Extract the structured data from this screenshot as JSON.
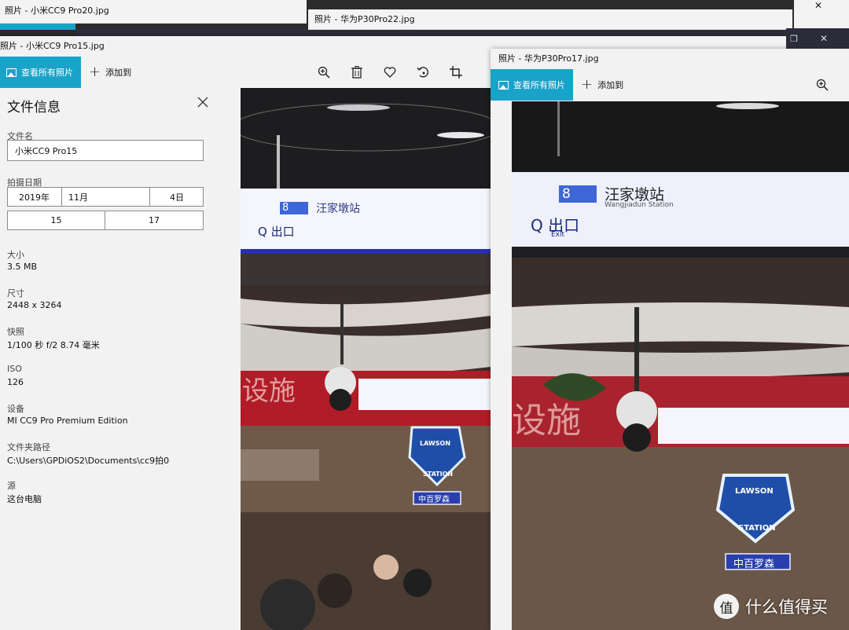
{
  "back_windows": {
    "win1_title": "照片 - 小米CC9 Pro20.jpg",
    "win2_title": "华为P30Pro22.jpg",
    "win2_prefix": "照片 - "
  },
  "main_window": {
    "title": "照片 - 小米CC9 Pro15.jpg",
    "toolbar": {
      "see_all": "查看所有照片",
      "add_to": "添加到",
      "icons": [
        "zoom-in-icon",
        "delete-icon",
        "heart-icon",
        "rotate-icon",
        "crop-icon"
      ]
    },
    "info_panel": {
      "title": "文件信息",
      "filename_label": "文件名",
      "filename_value": "小米CC9 Pro15",
      "date_label": "拍摄日期",
      "date_year": "2019年",
      "date_month": "11月",
      "date_day": "4日",
      "time_hour": "15",
      "time_minute": "17",
      "size_label": "大小",
      "size_value": "3.5 MB",
      "dimensions_label": "尺寸",
      "dimensions_value": "2448 x 3264",
      "shutter_label": "快照",
      "shutter_value": "1/100 秒 f/2 8.74 毫米",
      "iso_label": "ISO",
      "iso_value": "126",
      "device_label": "设备",
      "device_value": "MI CC9 Pro Premium Edition",
      "folder_label": "文件夹路径",
      "folder_value": "C:\\Users\\GPDiOS2\\Documents\\cc9拍0",
      "source_label": "源",
      "source_value": "这台电脑"
    }
  },
  "right_window": {
    "title": "照片 - 华为P30Pro17.jpg",
    "see_all": "查看所有照片",
    "add_to": "添加到"
  },
  "photo_text": {
    "station_name": "汪家墩站",
    "station_pinyin": "Wangjiadun Station",
    "exit": "出口",
    "exit_en": "Exit",
    "line_num": "8",
    "banner": "设施",
    "lawson_top": "LAWSON",
    "lawson_bottom": "STATION",
    "lawson_cn": "中百罗森"
  },
  "watermark": {
    "text": "什么值得买",
    "logo": "值"
  },
  "colors": {
    "accent": "#1aa3c9",
    "panel_bg": "#f2f2f2"
  }
}
